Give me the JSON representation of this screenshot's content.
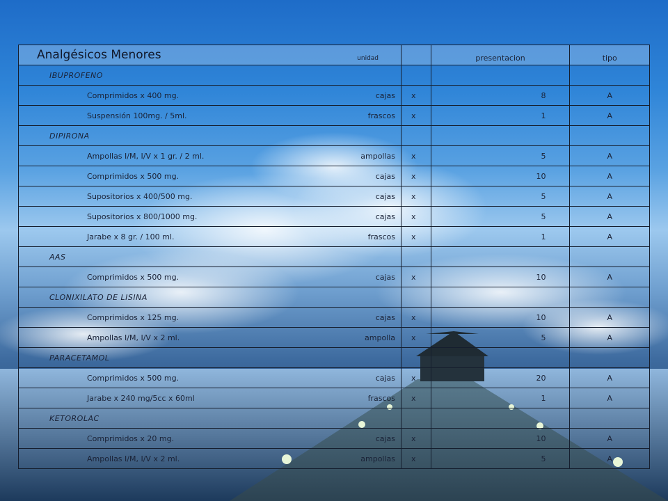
{
  "title": "Analgésicos Menores",
  "headers": {
    "unidad": "unidad",
    "presentacion": "presentacion",
    "tipo": "tipo"
  },
  "rows": [
    {
      "kind": "group",
      "label": "IBUPROFENO"
    },
    {
      "kind": "item",
      "desc": "Comprimidos  x 400 mg.",
      "unit": "cajas",
      "x": "x",
      "pres": "8",
      "tipo": "A"
    },
    {
      "kind": "item",
      "desc": "Suspensión  100mg. / 5ml.",
      "unit": "frascos",
      "x": "x",
      "pres": "1",
      "tipo": "A"
    },
    {
      "kind": "group",
      "label": "DIPIRONA"
    },
    {
      "kind": "item",
      "desc": "Ampollas I/M, I/V x 1 gr. / 2 ml.",
      "unit": "ampollas",
      "x": "x",
      "pres": "5",
      "tipo": "A"
    },
    {
      "kind": "item",
      "desc": "Comprimidos  x 500 mg.",
      "unit": "cajas",
      "x": "x",
      "pres": "10",
      "tipo": "A"
    },
    {
      "kind": "item",
      "desc": "Supositorios  x 400/500 mg.",
      "unit": "cajas",
      "x": "x",
      "pres": "5",
      "tipo": "A"
    },
    {
      "kind": "item",
      "desc": "Supositorios  x 800/1000 mg.",
      "unit": "cajas",
      "x": "x",
      "pres": "5",
      "tipo": "A"
    },
    {
      "kind": "item",
      "desc": "Jarabe x  8 gr. / 100 ml.",
      "unit": "frascos",
      "x": "x",
      "pres": "1",
      "tipo": "A"
    },
    {
      "kind": "group",
      "label": "AAS"
    },
    {
      "kind": "item",
      "desc": "Comprimidos  x 500 mg.",
      "unit": "cajas",
      "x": "x",
      "pres": "10",
      "tipo": "A"
    },
    {
      "kind": "group",
      "label": "CLONIXILATO DE LISINA"
    },
    {
      "kind": "item",
      "desc": "Comprimidos  x 125 mg.",
      "unit": "cajas",
      "x": "x",
      "pres": "10",
      "tipo": "A"
    },
    {
      "kind": "item",
      "desc": "Ampollas I/M, I/V x  2 ml.",
      "unit": "ampolla",
      "x": "x",
      "pres": "5",
      "tipo": "A"
    },
    {
      "kind": "group",
      "label": "PARACETAMOL"
    },
    {
      "kind": "item",
      "desc": "Comprimidos  x 500 mg.",
      "unit": "cajas",
      "x": "x",
      "pres": "20",
      "tipo": "A"
    },
    {
      "kind": "item",
      "desc": "Jarabe x 240 mg/5cc x 60ml",
      "unit": "frascos",
      "x": "x",
      "pres": "1",
      "tipo": "A"
    },
    {
      "kind": "group",
      "label": "KETOROLAC"
    },
    {
      "kind": "item",
      "desc": "Comprimidos  x 20 mg.",
      "unit": "cajas",
      "x": "x",
      "pres": "10",
      "tipo": "A"
    },
    {
      "kind": "item",
      "desc": "Ampollas I/M, I/V x  2 ml.",
      "unit": "ampollas",
      "x": "x",
      "pres": "5",
      "tipo": "A"
    }
  ]
}
